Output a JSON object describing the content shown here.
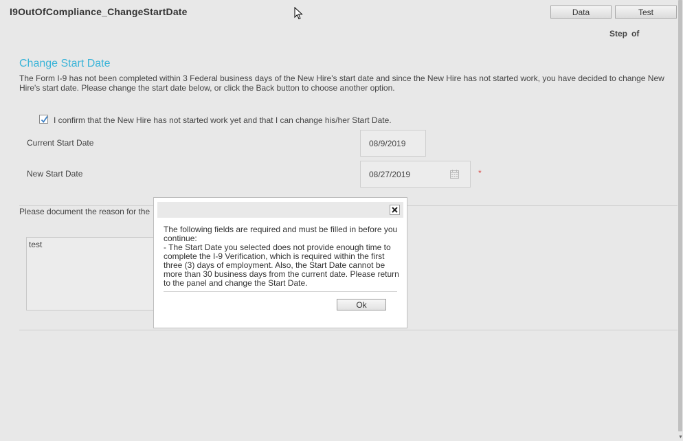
{
  "app": {
    "title": "I9OutOfCompliance_ChangeStartDate"
  },
  "header": {
    "data_button": "Data",
    "test_button": "Test",
    "step_label": "Step",
    "of_label": "of"
  },
  "form": {
    "section_title": "Change Start Date",
    "intro_text": "The Form I-9 has not been completed within 3 Federal business days of the New Hire's start date and since the New Hire has not started work, you have decided to change New Hire's start date. Please change the start date below, or click the Back button to choose another option.",
    "confirm_checked": true,
    "confirm_label": "I confirm that the New Hire has not started work yet and that I can change his/her Start Date.",
    "current_start_label": "Current Start Date",
    "current_start_value": "08/9/2019",
    "new_start_label": "New Start Date",
    "new_start_value": "08/27/2019",
    "required_marker": "*",
    "reason_label": "Please document the reason for the",
    "reason_value": "test"
  },
  "dialog": {
    "message_line1": "The following fields are required and must be filled in before you continue:",
    "message_line2": "- The Start Date you selected does not provide enough time to complete the I-9 Verification, which is required within the first three (3) days of employment. Also, the Start Date cannot be more than 30 business days from the current date. Please return to the panel and change the Start Date.",
    "ok_label": "Ok"
  },
  "colors": {
    "accent": "#3bb4d8",
    "background": "#e8e8e8",
    "required": "#d9534f"
  }
}
